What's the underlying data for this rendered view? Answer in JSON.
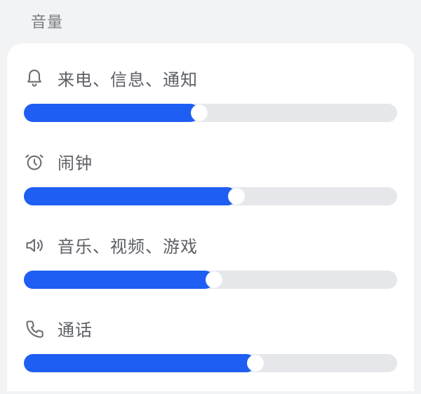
{
  "section_title": "音量",
  "sliders": [
    {
      "label": "来电、信息、通知",
      "value": 47
    },
    {
      "label": "闹钟",
      "value": 57
    },
    {
      "label": "音乐、视频、游戏",
      "value": 51
    },
    {
      "label": "通话",
      "value": 62
    }
  ]
}
